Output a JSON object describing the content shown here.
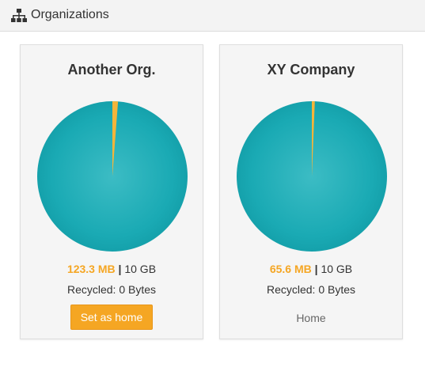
{
  "header": {
    "title": "Organizations",
    "icon": "sitemap-icon"
  },
  "colors": {
    "used": "#f5a623",
    "free": "#17a8b2",
    "button": "#f5a623"
  },
  "organizations": [
    {
      "name": "Another Org.",
      "used": "123.3 MB",
      "separator": "|",
      "total": "10 GB",
      "used_fraction": 0.012,
      "recycled": "Recycled: 0 Bytes",
      "action_label": "Set as home",
      "is_home": false
    },
    {
      "name": "XY Company",
      "used": "65.6 MB",
      "separator": "|",
      "total": "10 GB",
      "used_fraction": 0.0064,
      "recycled": "Recycled: 0 Bytes",
      "action_label": "Home",
      "is_home": true
    }
  ]
}
